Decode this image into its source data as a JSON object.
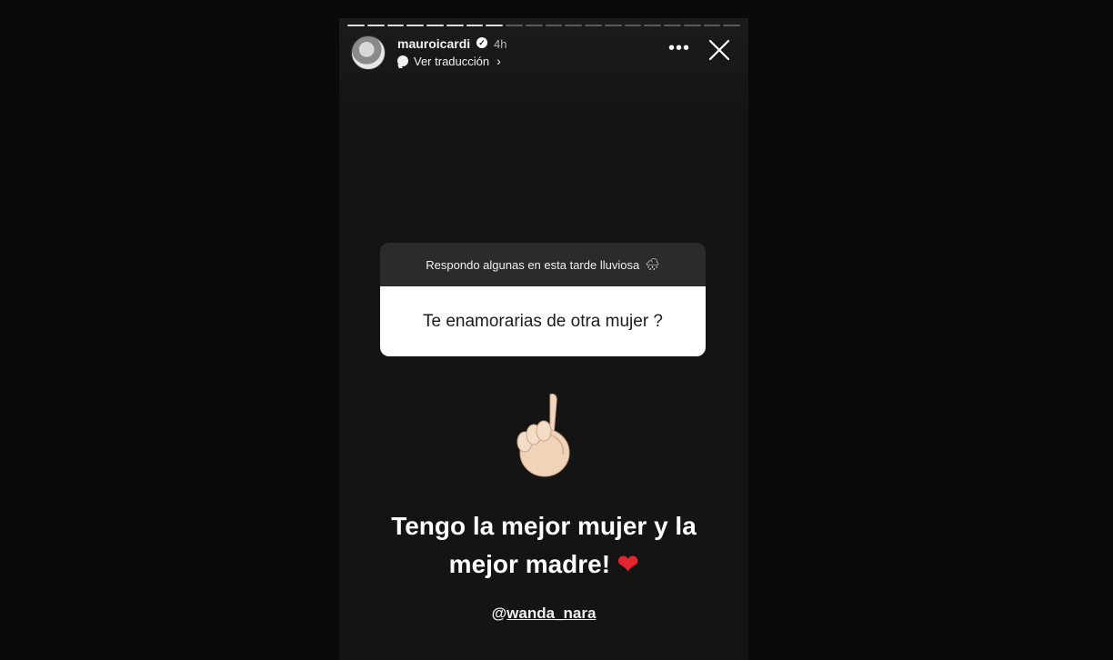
{
  "story": {
    "progress_total": 20,
    "progress_viewed": 8,
    "user": {
      "username": "mauroicardi",
      "verified": true,
      "time": "4h",
      "translate_label": "Ver traducción"
    },
    "question": {
      "prompt": "Respondo algunas en esta tarde lluviosa",
      "prompt_icon": "rain-cloud-icon",
      "text": "Te enamorarias de otra mujer ?"
    },
    "answer": {
      "line1": "Tengo la mejor mujer y la",
      "line2": "mejor madre!",
      "heart": "❤"
    },
    "mention_at": "@",
    "mention": "wanda_nara"
  },
  "icons": {
    "more": "more-dots-icon",
    "close": "close-icon",
    "sticker": "pointing-up-finger-icon"
  },
  "colors": {
    "background": "#0a0a0a",
    "story_bg": "#141414",
    "question_header": "#2b2b2b",
    "heart": "#e0262f"
  }
}
